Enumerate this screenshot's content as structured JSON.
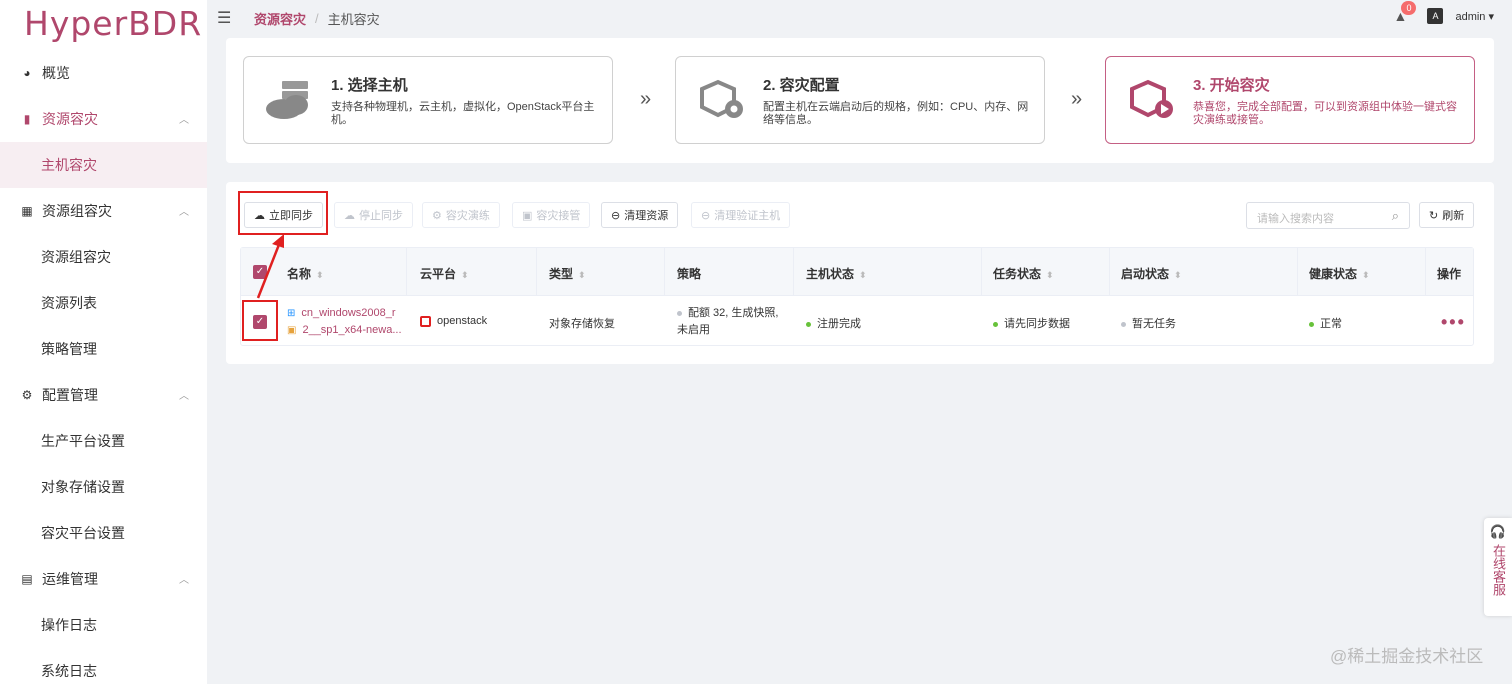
{
  "app": {
    "logo": "HyperBDR"
  },
  "sidebar": {
    "overview": "概览",
    "groups": [
      {
        "label": "资源容灾",
        "icon": "server-icon",
        "active": true
      },
      {
        "label": "资源组容灾",
        "icon": "building-icon"
      },
      {
        "label": "配置管理",
        "icon": "gear-icon"
      },
      {
        "label": "运维管理",
        "icon": "document-icon"
      }
    ],
    "sub": {
      "host_dr": "主机容灾",
      "group_dr": "资源组容灾",
      "resource_list": "资源列表",
      "policy_mgmt": "策略管理",
      "prod_platform": "生产平台设置",
      "object_storage": "对象存储设置",
      "dr_platform": "容灾平台设置",
      "op_log": "操作日志",
      "sys_log": "系统日志"
    }
  },
  "header": {
    "breadcrumb_parent": "资源容灾",
    "breadcrumb_current": "主机容灾",
    "notification_count": "0",
    "lang_icon": "A",
    "user": "admin ▾"
  },
  "steps": [
    {
      "title": "1. 选择主机",
      "desc": "支持各种物理机，云主机，虚拟化，OpenStack平台主机。"
    },
    {
      "title": "2. 容灾配置",
      "desc": "配置主机在云端启动后的规格，例如：CPU、内存、网络等信息。"
    },
    {
      "title": "3. 开始容灾",
      "desc": "恭喜您，完成全部配置，可以到资源组中体验一键式容灾演练或接管。"
    }
  ],
  "toolbar": {
    "sync_now": "立即同步",
    "stop_sync": "停止同步",
    "dr_drill": "容灾演练",
    "dr_takeover": "容灾接管",
    "clean_resources": "清理资源",
    "clean_verify_host": "清理验证主机",
    "search_placeholder": "请输入搜索内容",
    "refresh": "刷新"
  },
  "table": {
    "columns": [
      "名称",
      "云平台",
      "类型",
      "策略",
      "主机状态",
      "任务状态",
      "启动状态",
      "健康状态",
      "操作"
    ],
    "rows": [
      {
        "name_line1": "cn_windows2008_r",
        "name_line2": "2__sp1_x64-newa...",
        "platform": "openstack",
        "type": "对象存储恢复",
        "policy_line1": "配额 32, 生成快照,",
        "policy_line2": "未启用",
        "host_status": "注册完成",
        "task_status": "请先同步数据",
        "boot_status": "暂无任务",
        "health_status": "正常",
        "actions": "•••"
      }
    ]
  },
  "colors": {
    "brand": "#b0476c",
    "success": "#67c23a",
    "muted": "#c0c4cc"
  },
  "support": {
    "label": "在线客服"
  },
  "watermark": "@稀土掘金技术社区"
}
